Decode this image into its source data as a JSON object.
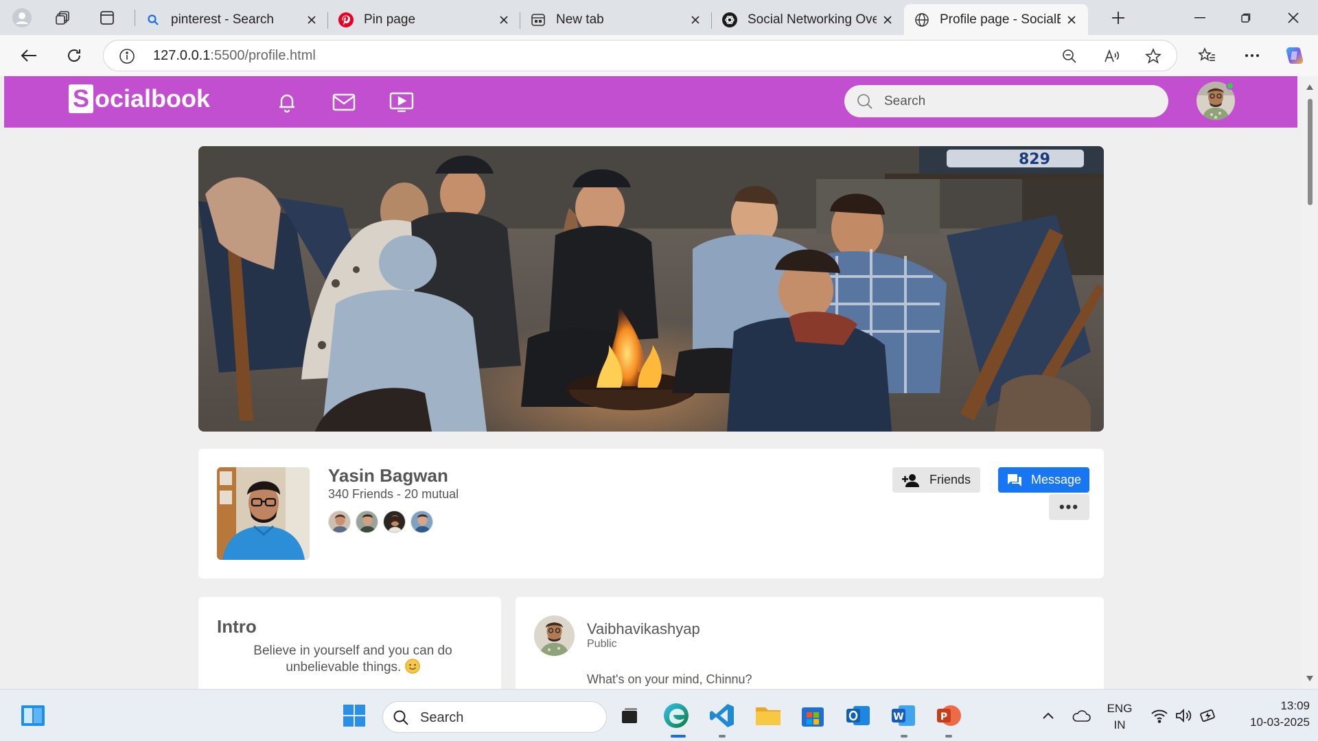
{
  "browser": {
    "tabs": [
      {
        "title": "pinterest - Search",
        "icon": "search-favicon"
      },
      {
        "title": "Pin page",
        "icon": "pinterest-favicon"
      },
      {
        "title": "New tab",
        "icon": "newtab-favicon"
      },
      {
        "title": "Social Networking Over",
        "icon": "chatgpt-favicon"
      },
      {
        "title": "Profile page - SocialBoo",
        "icon": "globe-favicon"
      }
    ],
    "url_host": "127.0.0.1",
    "url_rest": ":5500/profile.html"
  },
  "site": {
    "logo_s": "S",
    "logo_rest": "ocialbook",
    "search_placeholder": "Search",
    "brand_color": "#c14fcf"
  },
  "profile": {
    "name": "Yasin Bagwan",
    "friends_line": "340 Friends - 20 mutual",
    "friends_button": "Friends",
    "message_button": "Message",
    "more_button": "•••"
  },
  "intro": {
    "title": "Intro",
    "text": "Believe in yourself and you can do unbelievable things."
  },
  "post": {
    "author": "Vaibhavikashyap",
    "visibility": "Public",
    "placeholder": "What's on your mind, Chinnu?"
  },
  "taskbar": {
    "search_label": "Search",
    "lang_top": "ENG",
    "lang_bottom": "IN",
    "time": "13:09",
    "date": "10-03-2025"
  }
}
